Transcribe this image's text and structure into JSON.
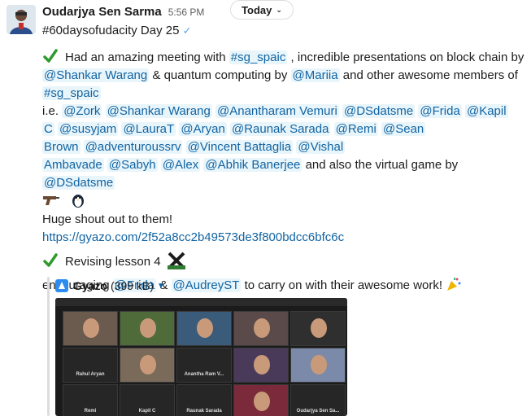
{
  "message": {
    "author": "Oudarjya Sen Sarma",
    "time": "5:56 PM",
    "title_line": "#60daysofudacity Day 25",
    "date_pill": "Today",
    "line1_text": "Had an amazing meeting with",
    "line1_channel": "#sg_spaic",
    "line1_rest": ", incredible presentations on block chain by",
    "line2_m1": "@Shankar Warang",
    "line2_t1": "& quantum computing by",
    "line2_m2": "@Mariia",
    "line2_t2": "and other awesome members of",
    "line3_channel": "#sg_spaic",
    "ie": "i.e.",
    "mentions_row1": [
      "@Zork",
      "@Shankar Warang",
      "@Anantharam Vemuri",
      "@DSdatsme",
      "@Frida",
      "@Kapil"
    ],
    "mentions_row2": [
      "C",
      "@susyjam",
      "@LauraT",
      "@Aryan",
      "@Raunak Sarada",
      "@Remi",
      "@Sean"
    ],
    "mentions_row3": [
      "Brown",
      "@adventuroussrv",
      "@Vincent Battaglia",
      "@Vishal"
    ],
    "mentions_row4": [
      "Ambavade",
      "@Sabyh",
      "@Alex",
      "@Abhik Banerjee"
    ],
    "row4_text": "and also the virtual game by",
    "row4_mention": "@DSdatsme",
    "shout": "Huge shout out to them!",
    "url": "https://gyazo.com/2f52a8cc2b49573de3f800bdcc6bfc6c",
    "revising": "Revising lesson 4",
    "enc_t1": "encouraging",
    "enc_m1": "@Frida",
    "enc_t2": "&",
    "enc_m2": "@AudreyST",
    "enc_t3": "to carry on with their awesome work!"
  },
  "attachment": {
    "name": "Gyazo",
    "size": "(399 kB)",
    "tiles": [
      {
        "label": ""
      },
      {
        "label": ""
      },
      {
        "label": ""
      },
      {
        "label": ""
      },
      {
        "label": ""
      },
      {
        "label": "Rahul Aryan"
      },
      {
        "label": ""
      },
      {
        "label": "Anantha Ram V..."
      },
      {
        "label": ""
      },
      {
        "label": ""
      },
      {
        "label": "Remi"
      },
      {
        "label": "Kapil C"
      },
      {
        "label": "Raunak Sarada"
      },
      {
        "label": ""
      },
      {
        "label": "Oudarjya Sen Sa..."
      }
    ]
  },
  "colors": {
    "mention": "#1264a3",
    "mention_bg": "#e8f5fa",
    "check": "#2e9b2e"
  },
  "icons": [
    "avatar",
    "check-icon",
    "vscode-icon",
    "gun-emoji-icon",
    "penguin-emoji-icon",
    "lesson-x-icon",
    "party-popper-icon",
    "gyazo-icon",
    "chevron-down-icon"
  ]
}
